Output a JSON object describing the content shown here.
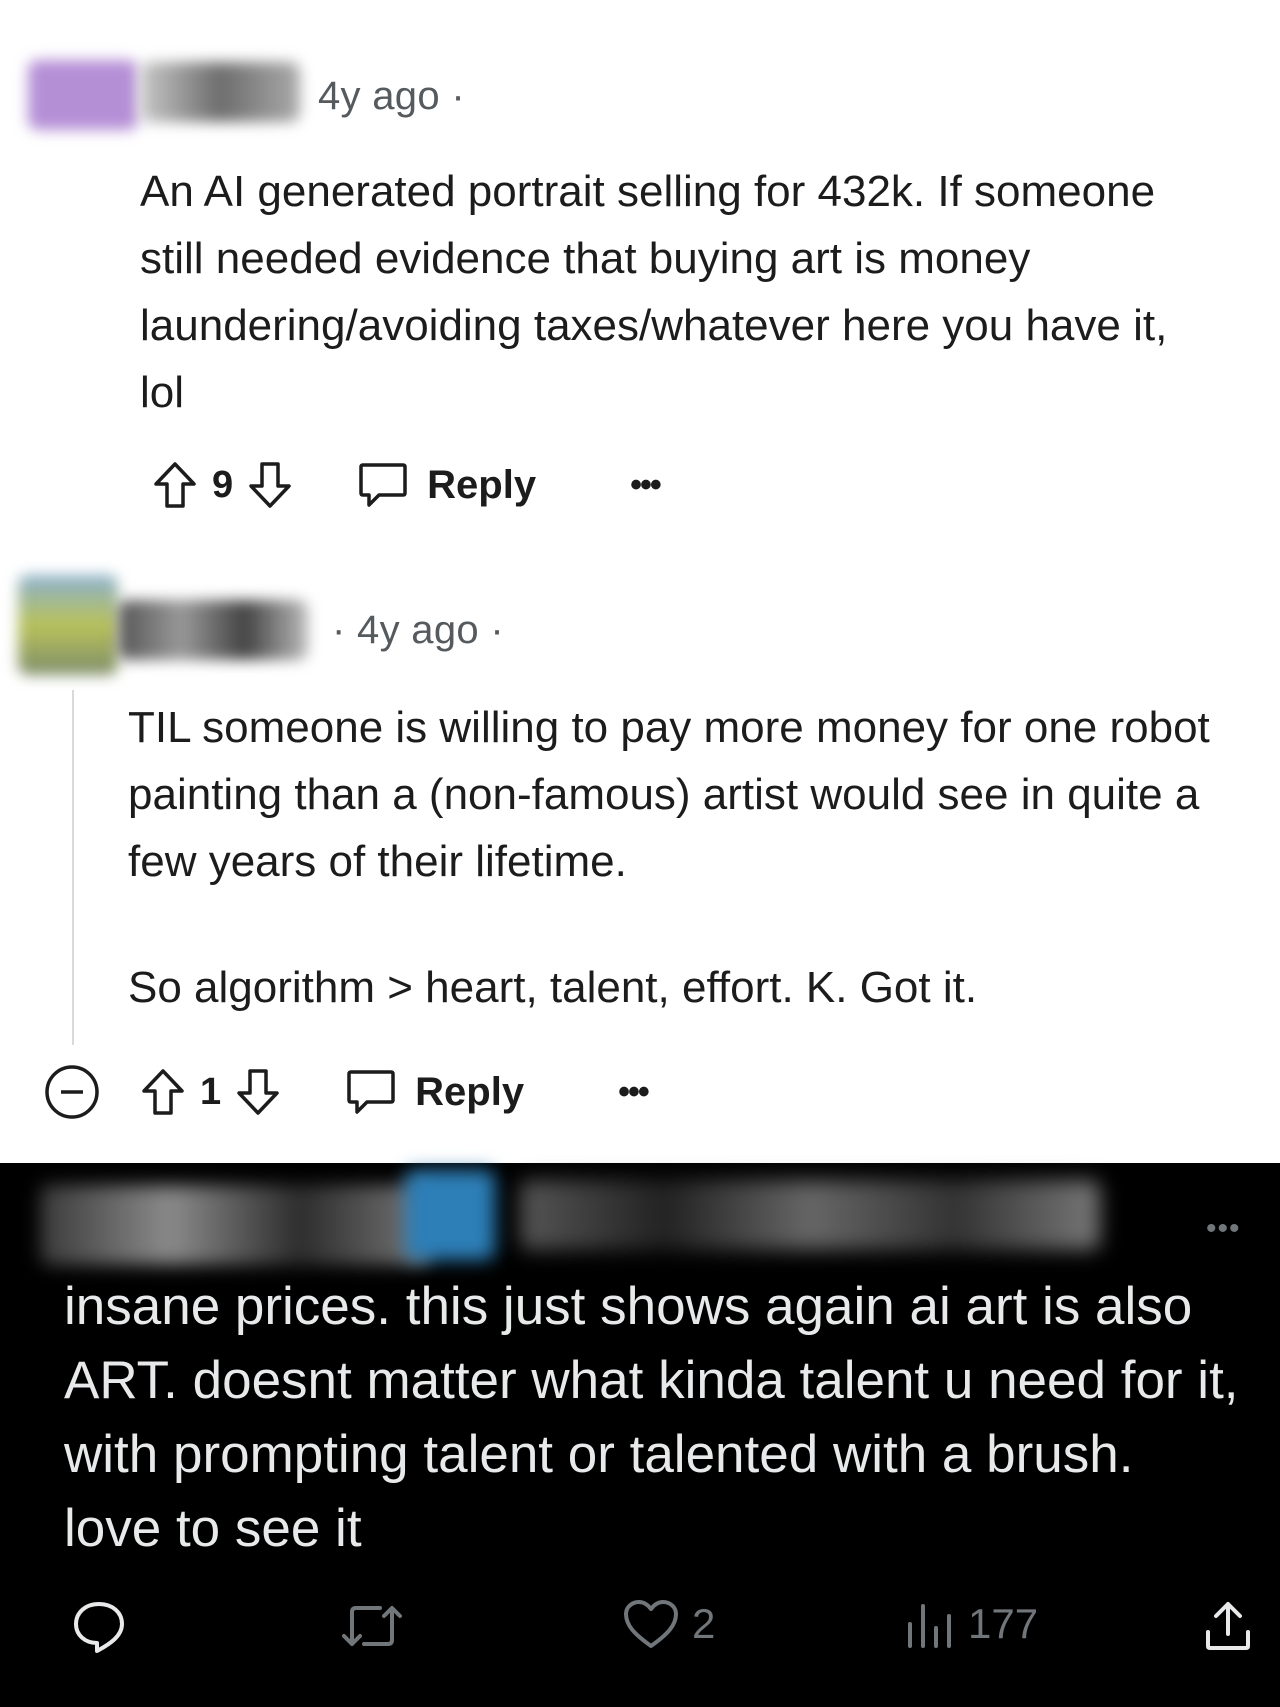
{
  "comment1": {
    "timestamp": "4y ago",
    "text": "An AI generated portrait selling for 432k. If someone still needed evidence that buying art is money laundering/avoiding taxes/whatever here you have it, lol",
    "votes": "9",
    "reply_label": "Reply",
    "more_label": "•••"
  },
  "comment2": {
    "timestamp": "4y ago",
    "text_p1": "TIL someone is willing to pay more money for one robot painting than a (non-famous) artist would see in quite a few years of their lifetime.",
    "text_p2": "So algorithm > heart, talent, effort. K. Got it.",
    "votes": "1",
    "reply_label": "Reply",
    "more_label": "•••"
  },
  "tweet": {
    "more_label": "•••",
    "text": "insane prices. this just shows again ai art is also ART. doesnt matter what kinda talent u need for it, with prompting talent or talented with a brush. love to see it",
    "likes": "2",
    "views": "177"
  },
  "icons": [
    "upvote-icon",
    "downvote-icon",
    "comment-bubble-icon",
    "collapse-icon",
    "reply-icon",
    "retweet-icon",
    "heart-icon",
    "views-icon",
    "share-icon"
  ],
  "colors": {
    "reddit_text": "#1c1c1c",
    "reddit_meta": "#555a5e",
    "tweet_bg": "#000000",
    "tweet_text": "#e7e9ea",
    "tweet_muted": "#71767b"
  }
}
